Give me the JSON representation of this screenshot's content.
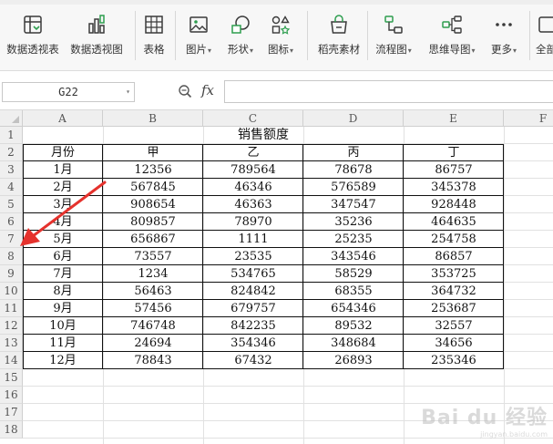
{
  "ribbon": {
    "tools": [
      {
        "label": "数据透视表",
        "icon": "pivot-table-icon",
        "dropdown": false
      },
      {
        "label": "数据透视图",
        "icon": "pivot-chart-icon",
        "dropdown": false
      },
      {
        "label": "表格",
        "icon": "table-icon",
        "dropdown": false
      },
      {
        "label": "图片",
        "icon": "picture-icon",
        "dropdown": true
      },
      {
        "label": "形状",
        "icon": "shape-icon",
        "dropdown": true
      },
      {
        "label": "图标",
        "icon": "icons-icon",
        "dropdown": true
      },
      {
        "label": "稻壳素材",
        "icon": "docer-material-icon",
        "dropdown": false
      },
      {
        "label": "流程图",
        "icon": "flowchart-icon",
        "dropdown": true
      },
      {
        "label": "思维导图",
        "icon": "mindmap-icon",
        "dropdown": true
      },
      {
        "label": "更多",
        "icon": "more-icon",
        "dropdown": true
      },
      {
        "label": "全部",
        "icon": "all-icon",
        "dropdown": false
      }
    ],
    "accent": "#2e9e4f"
  },
  "formula_bar": {
    "cell_ref": "G22",
    "fx_label": "fx",
    "formula": ""
  },
  "sheet": {
    "columns": [
      "A",
      "B",
      "C",
      "D",
      "E",
      "F"
    ],
    "rows": [
      "1",
      "2",
      "3",
      "4",
      "5",
      "6",
      "7",
      "8",
      "9",
      "10",
      "11",
      "12",
      "13",
      "14",
      "15",
      "16",
      "17",
      "18"
    ],
    "title": "销售额度",
    "headers": [
      "月份",
      "甲",
      "乙",
      "丙",
      "丁"
    ],
    "data": [
      [
        "1月",
        "12356",
        "789564",
        "78678",
        "86757"
      ],
      [
        "2月",
        "567845",
        "46346",
        "576589",
        "345378"
      ],
      [
        "3月",
        "908654",
        "46363",
        "347547",
        "928448"
      ],
      [
        "4月",
        "809857",
        "78970",
        "35236",
        "464635"
      ],
      [
        "5月",
        "656867",
        "1111",
        "25235",
        "254758"
      ],
      [
        "6月",
        "73557",
        "23535",
        "343546",
        "86857"
      ],
      [
        "7月",
        "1234",
        "534765",
        "58529",
        "353725"
      ],
      [
        "8月",
        "56463",
        "824842",
        "68355",
        "364732"
      ],
      [
        "9月",
        "57456",
        "679757",
        "654346",
        "253687"
      ],
      [
        "10月",
        "746748",
        "842235",
        "89532",
        "32557"
      ],
      [
        "11月",
        "24694",
        "354346",
        "348684",
        "34656"
      ],
      [
        "12月",
        "78843",
        "67432",
        "26893",
        "235346"
      ]
    ],
    "annotation_color": "#e5322d"
  },
  "watermark": {
    "brand": "Bai du 经验",
    "url": "jingyan.baidu.com"
  }
}
